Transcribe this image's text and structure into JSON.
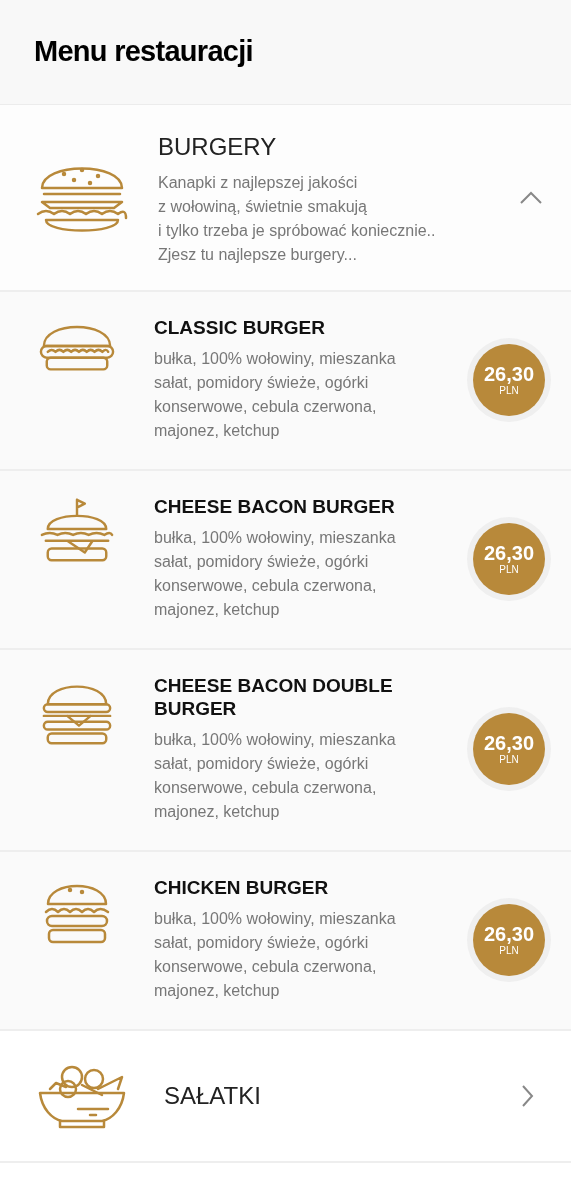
{
  "title": "Menu restauracji",
  "categories": [
    {
      "name": "BURGERY",
      "kind": "burger",
      "expanded": true,
      "description": "Kanapki z najlepszej jakości\nz wołowiną, świetnie smakują\ni tylko trzeba je spróbować koniecznie..\nZjesz tu najlepsze burgery...",
      "items": [
        {
          "kind": "classic",
          "name": "CLASSIC BURGER",
          "ingredients": "bułka, 100% wołowiny, mieszanka sałat, pomidory świeże, ogórki konserwowe, cebula czerwona, majonez, ketchup",
          "price": "26,30",
          "currency": "PLN"
        },
        {
          "kind": "flag",
          "name": "CHEESE BACON BURGER",
          "ingredients": "bułka, 100% wołowiny, mieszanka sałat, pomidory świeże, ogórki konserwowe, cebula czerwona, majonez, ketchup",
          "price": "26,30",
          "currency": "PLN"
        },
        {
          "kind": "double",
          "name": "CHEESE BACON DOUBLE BURGER",
          "ingredients": "bułka, 100% wołowiny, mieszanka sałat, pomidory świeże, ogórki konserwowe, cebula czerwona, majonez, ketchup",
          "price": "26,30",
          "currency": "PLN"
        },
        {
          "kind": "chicken",
          "name": "CHICKEN BURGER",
          "ingredients": "bułka, 100% wołowiny, mieszanka sałat, pomidory świeże, ogórki konserwowe, cebula czerwona, majonez, ketchup",
          "price": "26,30",
          "currency": "PLN"
        }
      ]
    },
    {
      "name": "SAŁATKI",
      "kind": "salad",
      "expanded": false
    }
  ]
}
